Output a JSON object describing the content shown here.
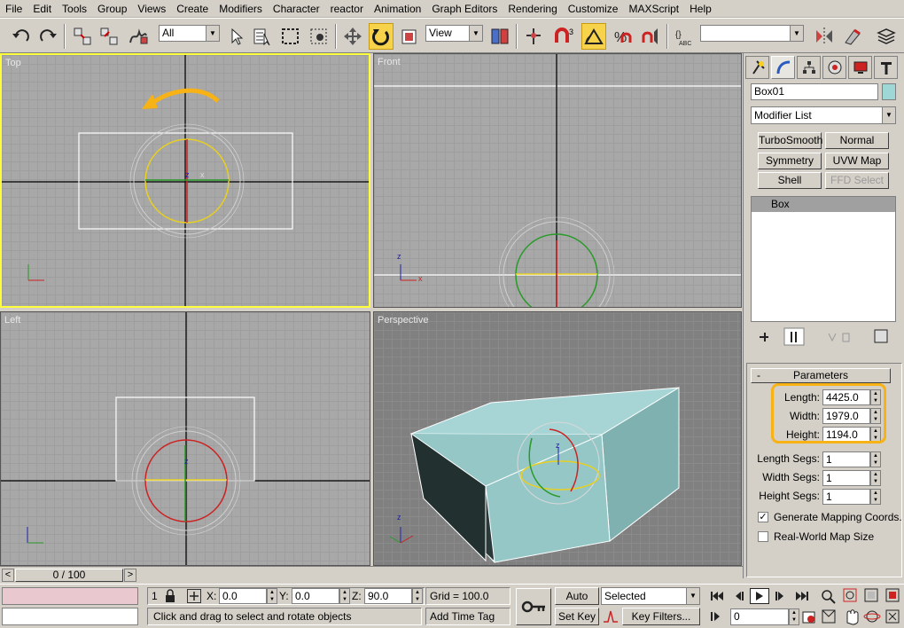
{
  "menu": [
    "File",
    "Edit",
    "Tools",
    "Group",
    "Views",
    "Create",
    "Modifiers",
    "Character",
    "reactor",
    "Animation",
    "Graph Editors",
    "Rendering",
    "Customize",
    "MAXScript",
    "Help"
  ],
  "toolbar": {
    "selection_filter": "All",
    "ref_coord": "View"
  },
  "viewports": {
    "top": "Top",
    "front": "Front",
    "left": "Left",
    "perspective": "Perspective"
  },
  "axis": {
    "x": "x",
    "y": "y",
    "z": "z"
  },
  "panel": {
    "object_name": "Box01",
    "object_color": "#9fd6d6",
    "modifier_list": "Modifier List",
    "modifier_buttons": [
      "TurboSmooth",
      "Normal",
      "Symmetry",
      "UVW Map",
      "Shell",
      "FFD Select"
    ],
    "stack_item": "Box",
    "rollout": "Parameters",
    "params": [
      {
        "label": "Length:",
        "value": "4425.0"
      },
      {
        "label": "Width:",
        "value": "1979.0"
      },
      {
        "label": "Height:",
        "value": "1194.0"
      }
    ],
    "segs": [
      {
        "label": "Length Segs:",
        "value": "1"
      },
      {
        "label": "Width Segs:",
        "value": "1"
      },
      {
        "label": "Height Segs:",
        "value": "1"
      }
    ],
    "gen_mapping": "Generate Mapping Coords.",
    "real_world": "Real-World Map Size",
    "rollout_minus": "-"
  },
  "timeline": {
    "frame": "0 / 100",
    "prev": "<",
    "next": ">"
  },
  "status": {
    "count": "1",
    "x_label": "X:",
    "x": "0.0",
    "y_label": "Y:",
    "y": "0.0",
    "z_label": "Z:",
    "z": "90.0",
    "grid": "Grid = 100.0",
    "prompt": "Click and drag to select and rotate objects",
    "add_time_tag": "Add Time Tag",
    "auto_key": "Auto Key",
    "set_key": "Set Key",
    "key_mode": "Selected",
    "key_filters": "Key Filters...",
    "current_frame": "0"
  },
  "accent": "#f7b215"
}
